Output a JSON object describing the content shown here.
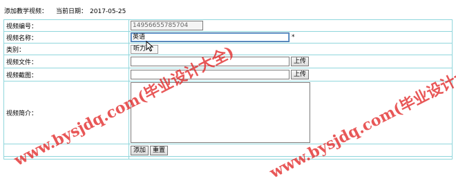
{
  "header": {
    "title": "添加教学视频：",
    "date_label": "当前日期：",
    "date_value": "2017-05-25"
  },
  "form": {
    "video_id": {
      "label": "视频编号：",
      "value": "14956655785704"
    },
    "video_name": {
      "label": "视频名称：",
      "value": "英语",
      "required_mark": "*"
    },
    "category": {
      "label": "类别：",
      "selected": "听力"
    },
    "video_file": {
      "label": "视频文件：",
      "value": "",
      "upload_label": "上传"
    },
    "screenshot": {
      "label": "视频截图：",
      "value": "",
      "upload_label": "上传"
    },
    "intro": {
      "label": "视频简介：",
      "value": ""
    },
    "buttons": {
      "add": "添加",
      "reset": "重置"
    }
  },
  "watermarks": [
    "www.bysjdq.com(毕业设计大全)",
    "www.bysjdq.com(毕业设计大"
  ],
  "colors": {
    "table_border": "#8fd6dc",
    "watermark": "#e12828"
  },
  "icons": {
    "cursor": "mouse-pointer-icon"
  }
}
